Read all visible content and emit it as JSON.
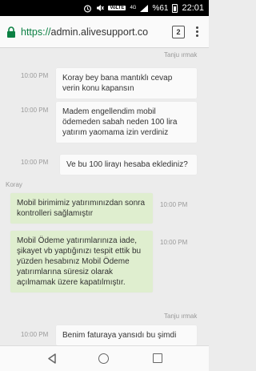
{
  "status_bar": {
    "network_label": "VoLTE",
    "network_type": "4G",
    "battery": "%61",
    "time": "22:01"
  },
  "browser": {
    "url_scheme": "https://",
    "url_host": "admin.alivesupport.co",
    "tab_count": "2"
  },
  "chat": {
    "agent_name": "Tanju ırmak",
    "customer_name": "Koray",
    "messages": [
      {
        "text": "Koray bey bana mantıklı cevap verin konu kapansın",
        "time": "10:00 PM"
      },
      {
        "text": "Madem engellendim mobil ödemeden sabah neden 100 lira yatırım yaomama izin verdiniz",
        "time": "10:00 PM"
      },
      {
        "text": "Ve bu 100 lirayı hesaba eklediniz?",
        "time": "10:00 PM"
      },
      {
        "text": "Mobil birimimiz yatırımınızdan sonra kontrolleri sağlamıştır",
        "time": "10:00 PM"
      },
      {
        "text": "Mobil Ödeme yatırımlarınıza iade, şikayet vb yaptığınızı tespit ettik bu yüzden hesabınız Mobil Ödeme yatırımlarına süresiz olarak açılmamak üzere kapatılmıştır.",
        "time": "10:00 PM"
      },
      {
        "text": "Benim faturaya yansıdı bu şimdi",
        "time": "10:00 PM"
      }
    ]
  }
}
